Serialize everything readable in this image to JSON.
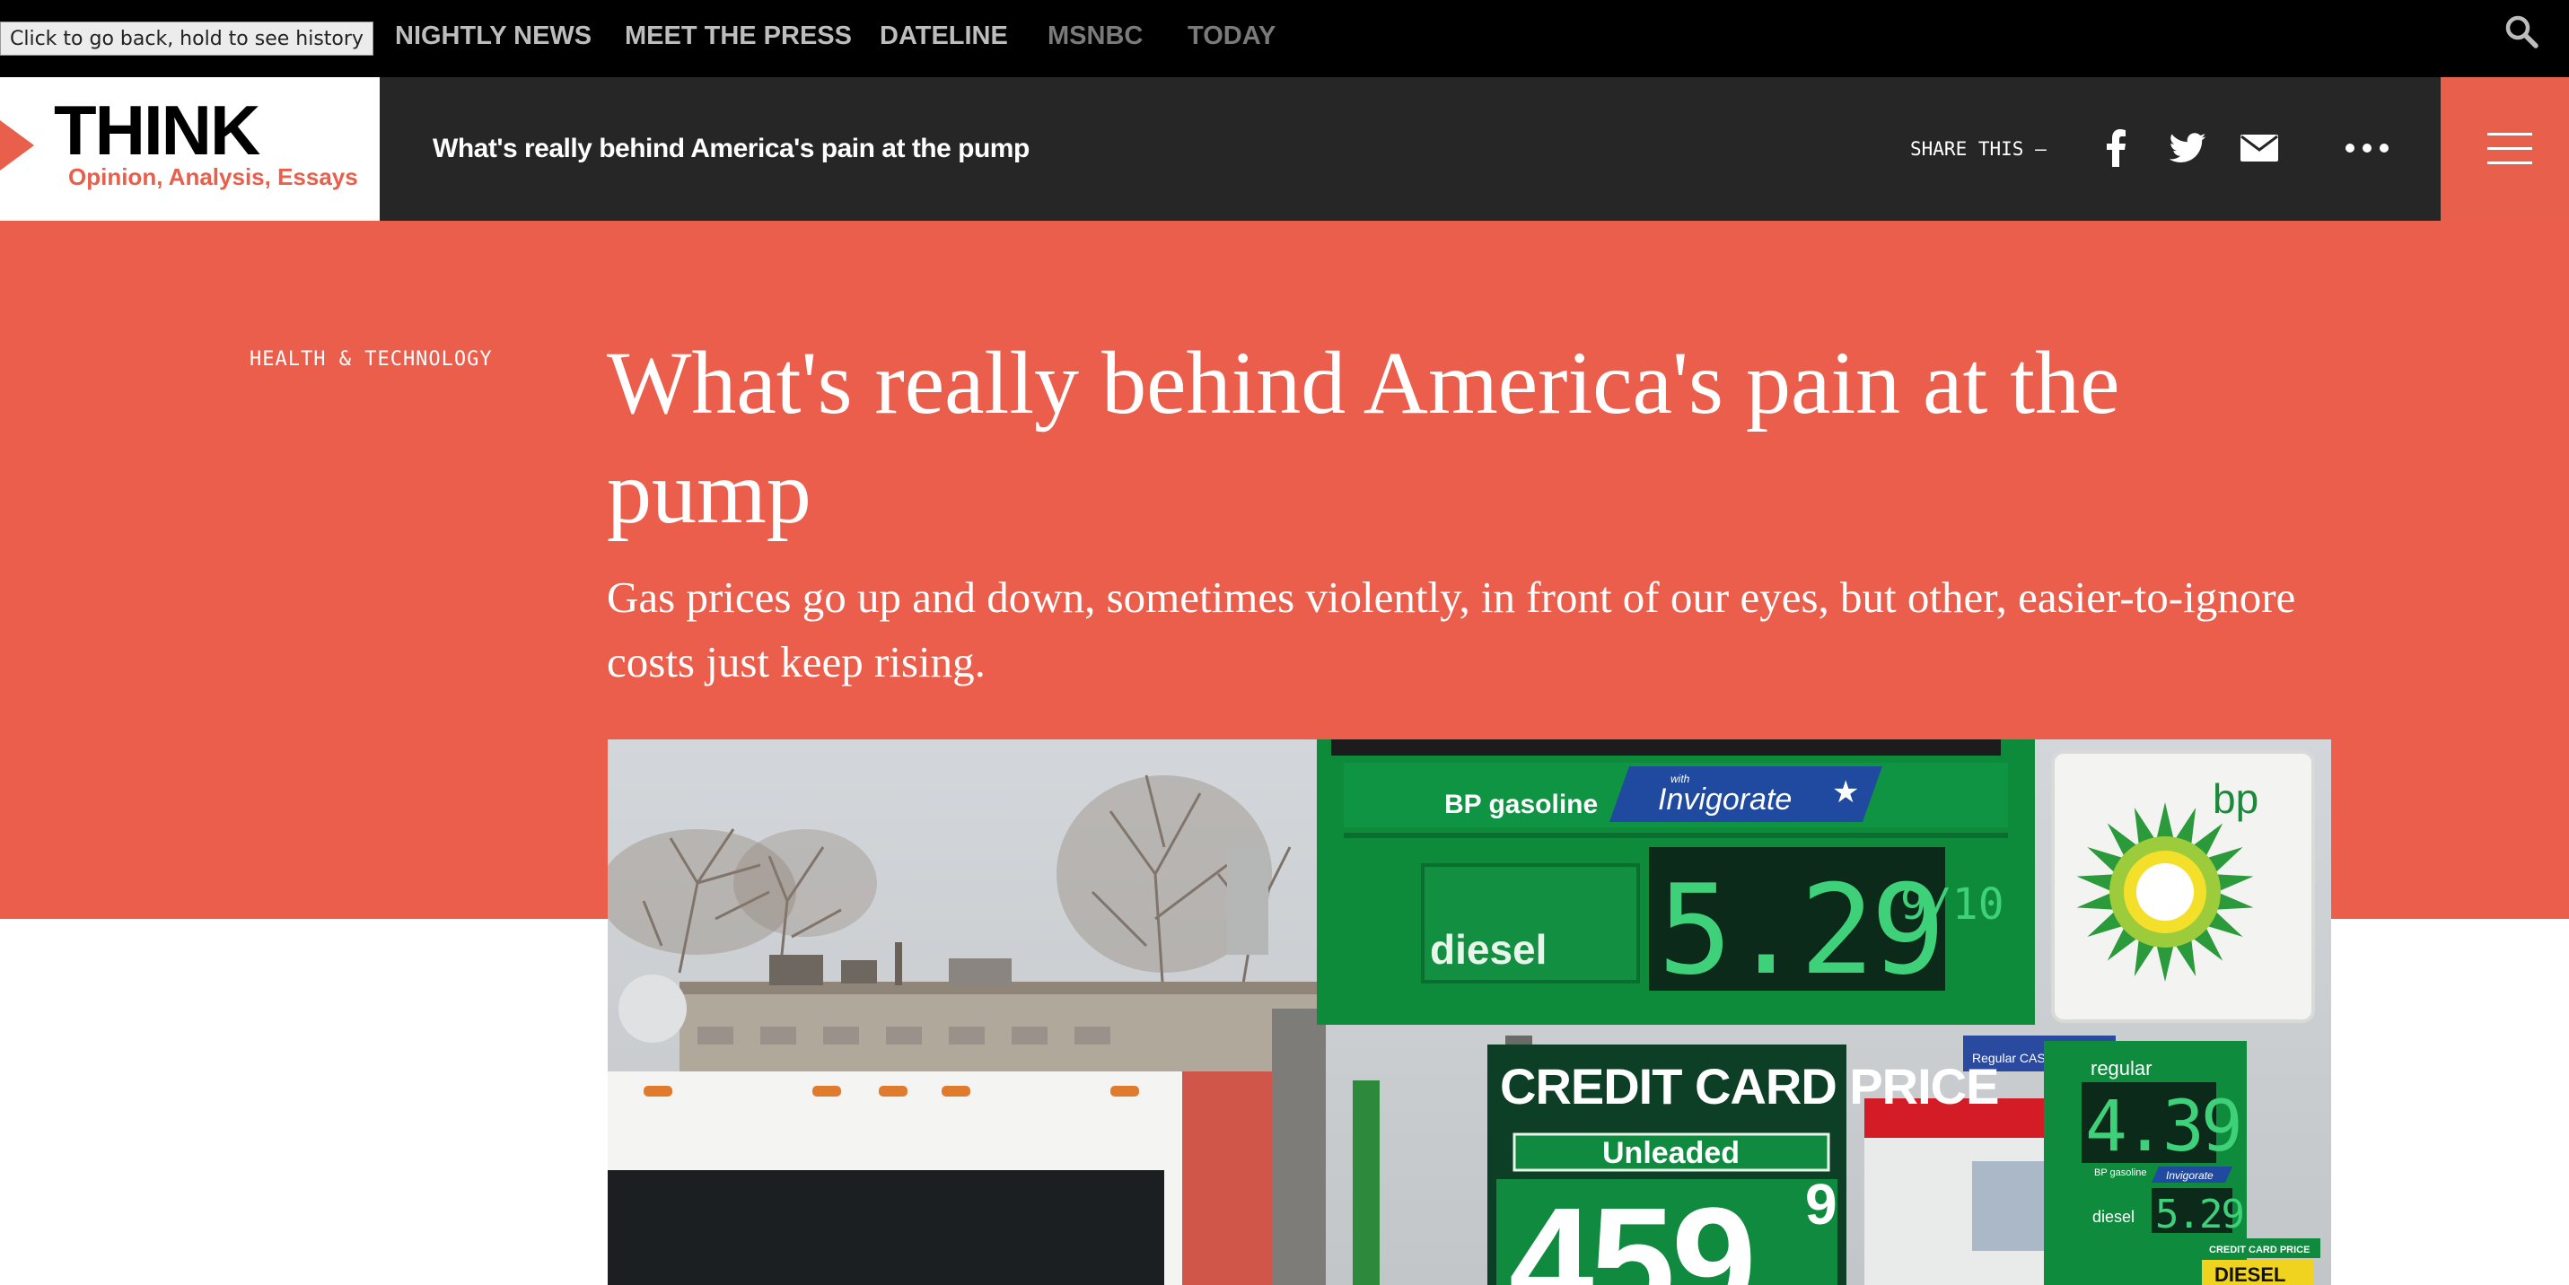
{
  "browser": {
    "tooltip": "Click to go back, hold to see history"
  },
  "topnav": {
    "links": [
      {
        "label": "NIGHTLY NEWS"
      },
      {
        "label": "MEET THE PRESS"
      },
      {
        "label": "DATELINE"
      },
      {
        "label": "MSNBC"
      },
      {
        "label": "TODAY"
      }
    ],
    "search_icon": "search-icon"
  },
  "header": {
    "brand": {
      "name": "THINK",
      "tagline": "Opinion, Analysis, Essays",
      "accent_color": "#e85f4b"
    },
    "article_title": "What's really behind America's pain at the pump",
    "share_label": "SHARE THIS —",
    "share_icons": [
      "facebook-icon",
      "twitter-icon",
      "email-icon",
      "more-icon"
    ],
    "menu_icon": "hamburger-menu-icon"
  },
  "article": {
    "category": "HEALTH & TECHNOLOGY",
    "headline": "What's really behind America's pain at the pump",
    "dek": "Gas prices go up and down, sometimes violently, in front of our eyes, but other, easier-to-ignore costs just keep rising.",
    "hero_color": "#eb5e4c"
  },
  "photo": {
    "sign_brand": "BP gasoline",
    "sign_brand_badge": "Invigorate",
    "sign_brand_badge_small": "with",
    "diesel_label": "diesel",
    "diesel_price": "5.29",
    "diesel_price_frac": "9/10",
    "bp_logo_text": "bp",
    "credit_card_label": "CREDIT CARD PRICE",
    "unleaded_label": "Unleaded",
    "unleaded_price": "459",
    "unleaded_price_frac": "9",
    "small_sign_header": "Regular CASH",
    "regular_label": "regular",
    "regular_price": "4.39",
    "small_sign_brand": "BP gasoline",
    "small_sign_badge": "Invigorate",
    "small_diesel_label": "diesel",
    "small_diesel_price": "5.29",
    "small_cc_label": "CREDIT CARD PRICE",
    "small_diesel_tag": "DIESEL"
  }
}
